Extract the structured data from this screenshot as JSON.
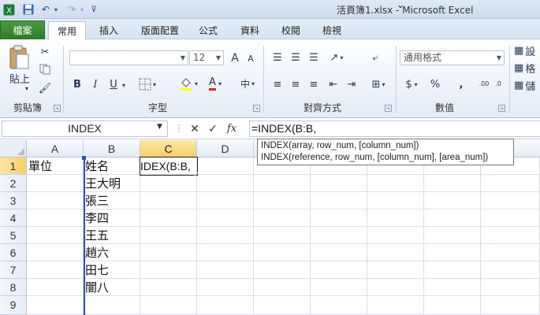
{
  "window": {
    "title_doc": "活頁簿1.xlsx",
    "title_app": "Microsoft Excel"
  },
  "tabs": [
    "檔案",
    "常用",
    "插入",
    "版面配置",
    "公式",
    "資料",
    "校閱",
    "檢視"
  ],
  "ribbon": {
    "clipboard": {
      "paste_label": "貼上",
      "group_label": "剪貼簿"
    },
    "font": {
      "size_value": "12",
      "group_label": "字型",
      "bold": "B",
      "italic": "I",
      "underline": "U",
      "grow": "A",
      "shrink": "A",
      "font_color": "A"
    },
    "alignment": {
      "group_label": "對齊方式"
    },
    "number": {
      "format_value": "通用格式",
      "currency": "$",
      "percent": "%",
      "comma": ",",
      "inc_decimal": ".00",
      "group_label": "數值"
    },
    "styles": {
      "items": [
        "設",
        "格",
        "儲"
      ]
    }
  },
  "formula_bar": {
    "name_box": "INDEX",
    "cancel": "✕",
    "enter": "✓",
    "fx": "fx",
    "formula": "=INDEX(B:B,"
  },
  "tooltip": {
    "line1": "INDEX(array, row_num, [column_num])",
    "line2": "INDEX(reference, row_num, [column_num], [area_num])"
  },
  "sheet": {
    "columns": [
      "A",
      "B",
      "C",
      "D"
    ],
    "rows": [
      "1",
      "2",
      "3",
      "4",
      "5",
      "6",
      "7",
      "8",
      "9"
    ],
    "cells": {
      "A1": "單位",
      "B1": "姓名",
      "B2": "王大明",
      "B3": "張三",
      "B4": "李四",
      "B5": "王五",
      "B6": "趙六",
      "B7": "田七",
      "B8": "闇八",
      "C1": "IDEX(B:B,"
    }
  }
}
